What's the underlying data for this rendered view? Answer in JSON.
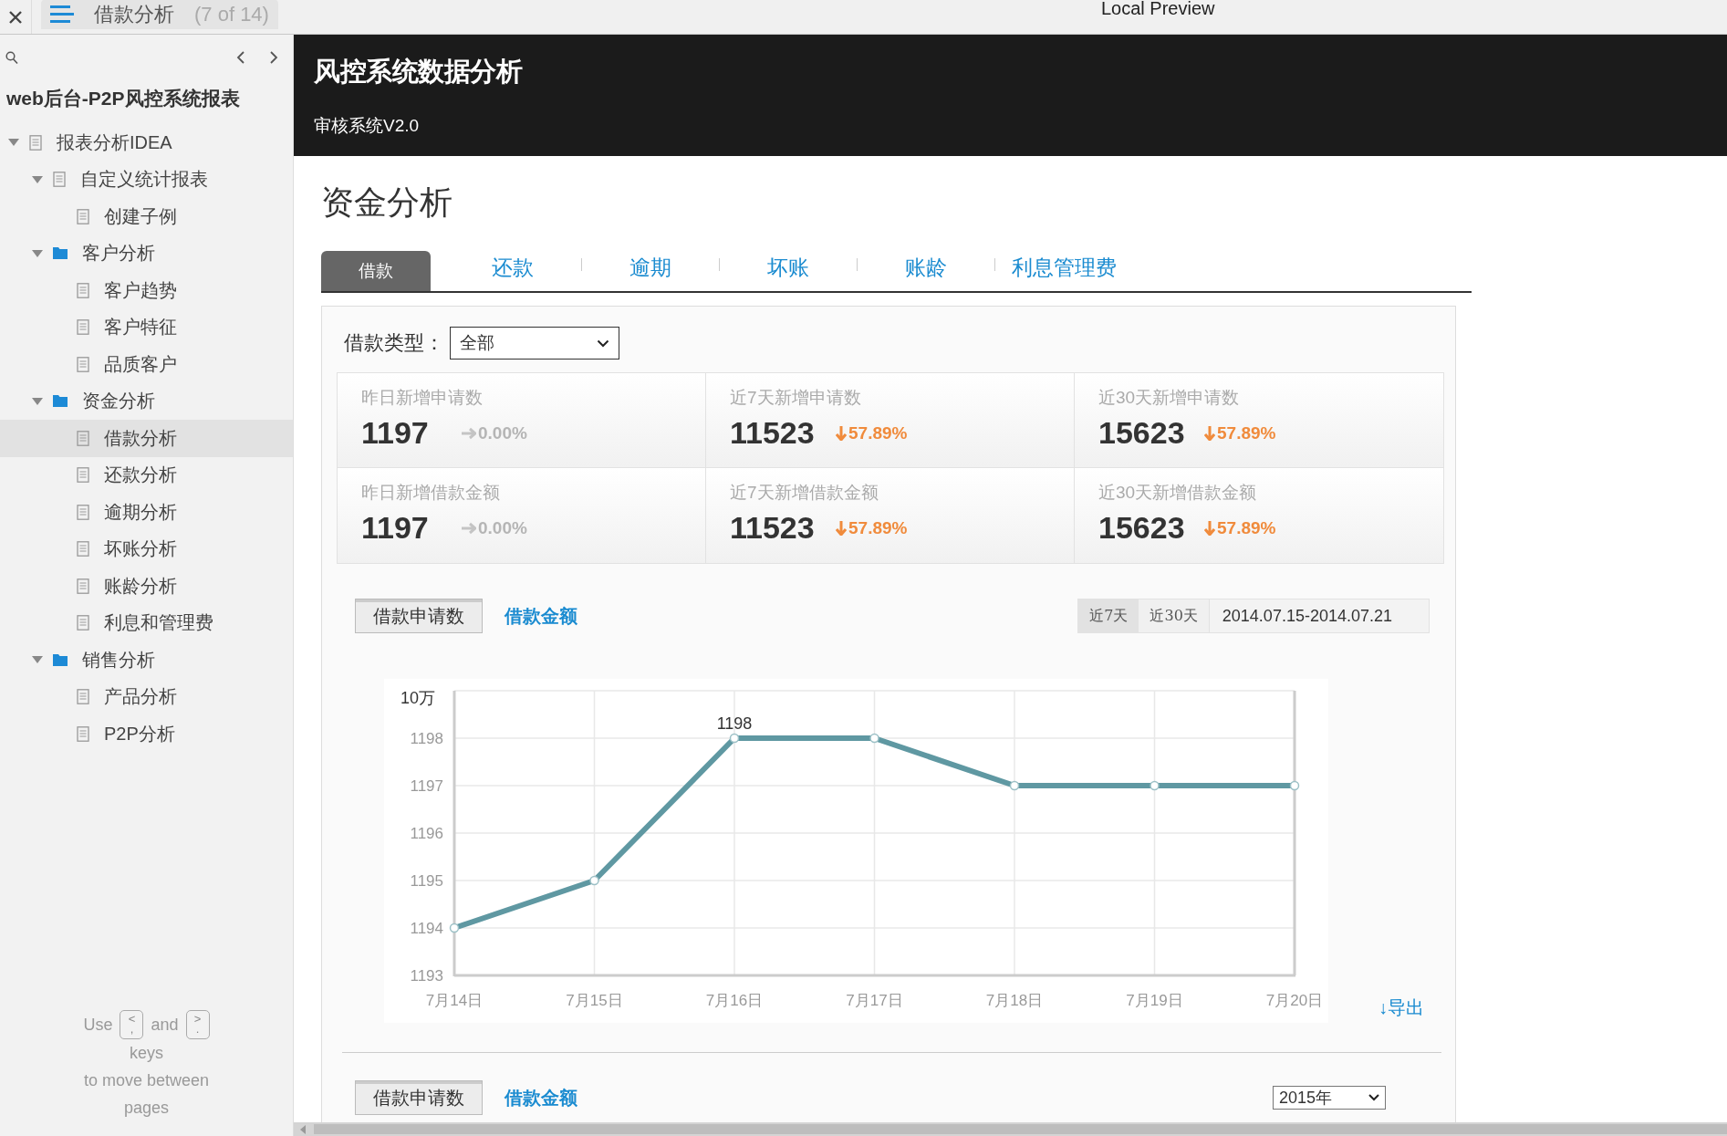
{
  "toolbar": {
    "page_title": "借款分析",
    "page_counter": "(7 of 14)",
    "window_title": "Local Preview"
  },
  "sidebar": {
    "title": "web后台-P2P风控系统报表",
    "tree": [
      {
        "label": "报表分析IDEA",
        "kind": "doc",
        "expanded": true,
        "selected": false,
        "children": [
          {
            "label": "自定义统计报表",
            "kind": "doc",
            "expanded": true,
            "selected": false,
            "children": [
              {
                "label": "创建子例",
                "kind": "doc",
                "selected": false
              }
            ]
          },
          {
            "label": "客户分析",
            "kind": "folder",
            "expanded": true,
            "selected": false,
            "children": [
              {
                "label": "客户趋势",
                "kind": "doc",
                "selected": false
              },
              {
                "label": "客户特征",
                "kind": "doc",
                "selected": false
              },
              {
                "label": "品质客户",
                "kind": "doc",
                "selected": false
              }
            ]
          },
          {
            "label": "资金分析",
            "kind": "folder",
            "expanded": true,
            "selected": false,
            "children": [
              {
                "label": "借款分析",
                "kind": "doc",
                "selected": true
              },
              {
                "label": "还款分析",
                "kind": "doc",
                "selected": false
              },
              {
                "label": "逾期分析",
                "kind": "doc",
                "selected": false
              },
              {
                "label": "坏账分析",
                "kind": "doc",
                "selected": false
              },
              {
                "label": "账龄分析",
                "kind": "doc",
                "selected": false
              },
              {
                "label": "利息和管理费",
                "kind": "doc",
                "selected": false
              }
            ]
          },
          {
            "label": "销售分析",
            "kind": "folder",
            "expanded": true,
            "selected": false,
            "children": [
              {
                "label": "产品分析",
                "kind": "doc",
                "selected": false
              },
              {
                "label": "P2P分析",
                "kind": "doc",
                "selected": false
              }
            ]
          }
        ]
      }
    ],
    "hint": {
      "before": "Use",
      "key_prev": "<,",
      "middle": "and",
      "key_next": ">.",
      "after": "keys",
      "last": "to move between pages"
    }
  },
  "header": {
    "title": "风控系统数据分析",
    "subtitle": "审核系统V2.0"
  },
  "page_title": "资金分析",
  "tabs": [
    {
      "label": "借款",
      "selected": true
    },
    {
      "label": "还款",
      "selected": false
    },
    {
      "label": "逾期",
      "selected": false
    },
    {
      "label": "坏账",
      "selected": false
    },
    {
      "label": "账龄",
      "selected": false
    },
    {
      "label": "利息管理费",
      "selected": false
    }
  ],
  "filter": {
    "label": "借款类型：",
    "value": "全部"
  },
  "stats": [
    {
      "label": "昨日新增申请数",
      "value": "1197",
      "change": "0.00%",
      "kind": "flat"
    },
    {
      "label": "近7天新增申请数",
      "value": "11523",
      "change": "57.89%",
      "kind": "down"
    },
    {
      "label": "近30天新增申请数",
      "value": "15623",
      "change": "57.89%",
      "kind": "down"
    },
    {
      "label": "昨日新增借款金额",
      "value": "1197",
      "change": "0.00%",
      "kind": "flat"
    },
    {
      "label": "近7天新增借款金额",
      "value": "11523",
      "change": "57.89%",
      "kind": "down"
    },
    {
      "label": "近30天新增借款金额",
      "value": "15623",
      "change": "57.89%",
      "kind": "down"
    }
  ],
  "chart_section": {
    "metric_toggle": [
      {
        "label": "借款申请数",
        "selected": true
      },
      {
        "label": "借款金额",
        "selected": false
      }
    ],
    "ranges": [
      {
        "label": "近7天",
        "selected": true
      },
      {
        "label": "近30天",
        "selected": false
      }
    ],
    "date_range": "2014.07.15-2014.07.21",
    "chart_data": {
      "type": "line",
      "ylabel": "10万",
      "categories": [
        "7月14日",
        "7月15日",
        "7月16日",
        "7月17日",
        "7月18日",
        "7月19日",
        "7月20日"
      ],
      "series": [
        {
          "color": "#5f98a2",
          "marker": "circle",
          "values": [
            1194,
            1195,
            1198,
            1198,
            1197,
            1197,
            1197
          ]
        }
      ],
      "grid": true,
      "ylim": [
        1193,
        1199
      ],
      "yticks": [
        1193,
        1194,
        1195,
        1196,
        1197,
        1198
      ],
      "annotations": [
        {
          "x": "7月16日",
          "y": 1198,
          "text": "1198"
        }
      ]
    },
    "export": "↓导出"
  },
  "next_section": {
    "metric_toggle": [
      {
        "label": "借款申请数",
        "selected": true
      },
      {
        "label": "借款金额",
        "selected": false
      }
    ],
    "year": "2015年"
  }
}
